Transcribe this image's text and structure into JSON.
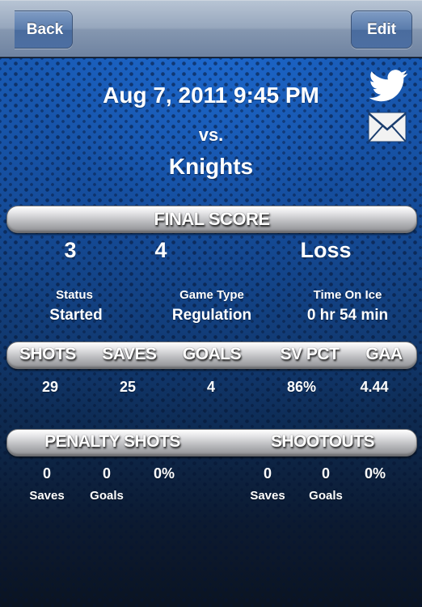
{
  "navbar": {
    "back_label": "Back",
    "edit_label": "Edit"
  },
  "game": {
    "date": "Aug 7, 2011 9:45 PM",
    "vs": "vs.",
    "opponent": "Knights"
  },
  "share": {
    "twitter_icon": "twitter-bird-icon",
    "mail_icon": "envelope-icon"
  },
  "final_score": {
    "header": "FINAL SCORE",
    "team_score": "3",
    "opponent_score": "4",
    "result": "Loss"
  },
  "info": [
    {
      "label": "Status",
      "value": "Started"
    },
    {
      "label": "Game Type",
      "value": "Regulation"
    },
    {
      "label": "Time On Ice",
      "value": "0 hr 54 min"
    }
  ],
  "stats": {
    "headers": [
      "SHOTS",
      "SAVES",
      "GOALS",
      "SV PCT",
      "GAA"
    ],
    "values": [
      "29",
      "25",
      "4",
      "86%",
      "4.44"
    ]
  },
  "penalty_shots": {
    "header": "PENALTY SHOTS",
    "saves": "0",
    "goals": "0",
    "pct": "0%",
    "saves_label": "Saves",
    "goals_label": "Goals"
  },
  "shootouts": {
    "header": "SHOOTOUTS",
    "saves": "0",
    "goals": "0",
    "pct": "0%",
    "saves_label": "Saves",
    "goals_label": "Goals"
  },
  "colors": {
    "navbar_button": "#5a7cac",
    "background_top": "#1b5fb8",
    "background_bottom": "#0b1422",
    "text": "#ffffff"
  }
}
